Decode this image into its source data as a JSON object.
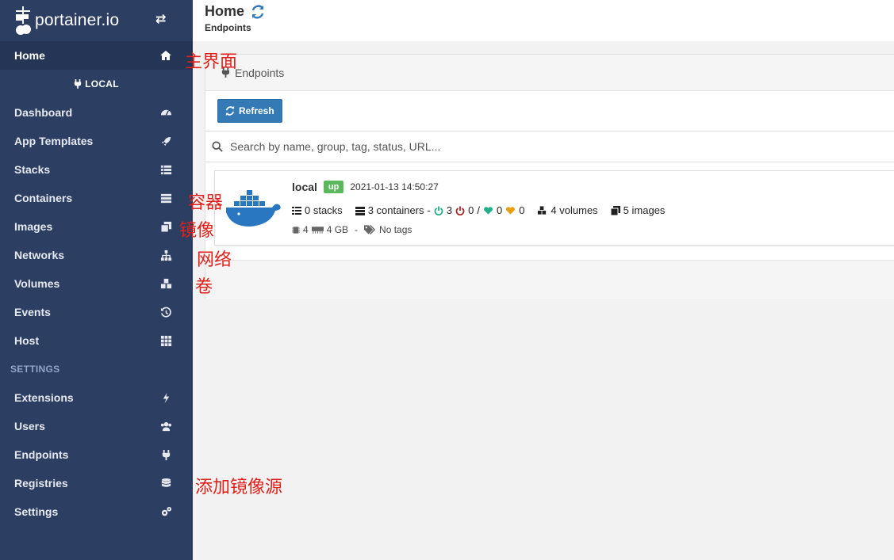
{
  "brand": {
    "name": "portainer.io"
  },
  "sidebar": {
    "home": "Home",
    "endpoint_name": "LOCAL",
    "items": [
      {
        "label": "Dashboard",
        "icon": "dashboard-icon"
      },
      {
        "label": "App Templates",
        "icon": "rocket-icon"
      },
      {
        "label": "Stacks",
        "icon": "list-icon"
      },
      {
        "label": "Containers",
        "icon": "server-icon"
      },
      {
        "label": "Images",
        "icon": "clone-icon"
      },
      {
        "label": "Networks",
        "icon": "sitemap-icon"
      },
      {
        "label": "Volumes",
        "icon": "cubes-icon"
      },
      {
        "label": "Events",
        "icon": "history-icon"
      },
      {
        "label": "Host",
        "icon": "th-icon"
      }
    ],
    "settings_section": "SETTINGS",
    "settings_items": [
      {
        "label": "Extensions",
        "icon": "bolt-icon"
      },
      {
        "label": "Users",
        "icon": "users-icon"
      },
      {
        "label": "Endpoints",
        "icon": "plug-icon"
      },
      {
        "label": "Registries",
        "icon": "database-icon"
      },
      {
        "label": "Settings",
        "icon": "cogs-icon"
      }
    ]
  },
  "header": {
    "title": "Home",
    "breadcrumb": "Endpoints"
  },
  "widget": {
    "title": "Endpoints",
    "refresh_label": "Refresh",
    "search_placeholder": "Search by name, group, tag, status, URL..."
  },
  "endpoint": {
    "name": "local",
    "status": "up",
    "date": "2021-01-13 14:50:27",
    "stacks": "0 stacks",
    "containers": "3 containers",
    "running": "3",
    "stopped": "0",
    "healthy": "0",
    "unhealthy": "0",
    "volumes": "4 volumes",
    "images": "5 images",
    "cpu": "4",
    "memory": "4 GB",
    "tags": "No tags"
  },
  "annotations": {
    "home": "主界面",
    "containers": "容器",
    "images": "镜像",
    "networks": "网络",
    "volumes": "卷",
    "registries": "添加镜像源"
  },
  "colors": {
    "sidebar": "#2d3e63",
    "accent": "#337ab7",
    "up": "#5cb85c",
    "annotation": "#e0201a"
  }
}
